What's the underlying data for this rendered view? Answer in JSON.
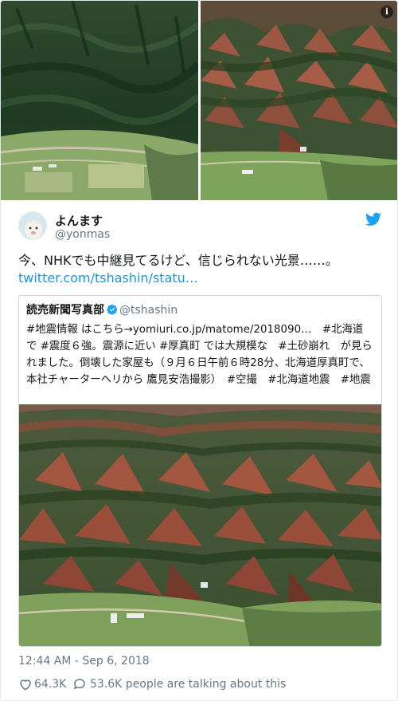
{
  "colors": {
    "link": "#1b95e0",
    "text": "#14171a",
    "secondary": "#657786",
    "border": "#ccd6dd",
    "twitter_blue": "#1da1f2"
  },
  "media": {
    "left_alt": "",
    "right_alt": "",
    "info_icon": "info-icon",
    "info_glyph": "i"
  },
  "tweet": {
    "display_name": "よんます",
    "handle": "@yonmas",
    "text_main": "今、NHKでも中継見てるけど、信じられない光景……。",
    "link": "twitter.com/tshashin/statu…",
    "timestamp": "12:44 AM - Sep 6, 2018",
    "likes": "64.3K",
    "talking": "53.6K people are talking about this"
  },
  "quote": {
    "name": "読売新聞写真部",
    "handle": "@tshashin",
    "text": "#地震情報 はこちら→yomiuri.co.jp/matome/2018090…　#北海道 で #震度６強。震源に近い #厚真町 では大規模な　#土砂崩れ　が見られました。倒壊した家屋も（９月６日午前６時28分、北海道厚真町で、本社チャーターヘリから 鷹見安浩撮影）　#空撮　#北海道地震　#地震"
  }
}
